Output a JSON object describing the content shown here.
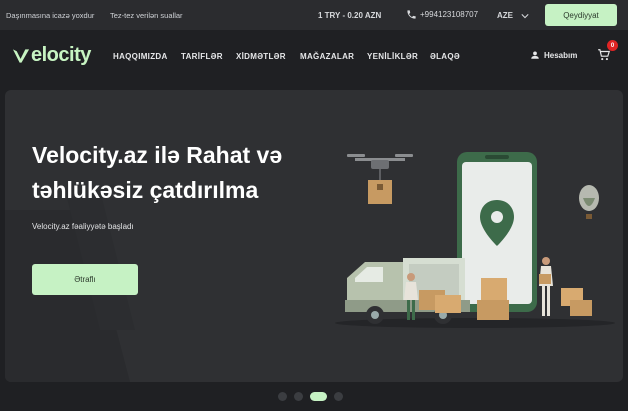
{
  "topbar": {
    "shipping_link": "Daşınmasına icazə yoxdur",
    "faq_link": "Tez-tez verilən suallar",
    "currency_rate": "1 TRY - 0.20 AZN",
    "phone": "+994123108707",
    "language": "AZE",
    "register_label": "Qeydiyyat"
  },
  "nav": {
    "logo": "elocity",
    "items": [
      {
        "label": "HAQQIMIZDA"
      },
      {
        "label": "TARİFLƏR"
      },
      {
        "label": "XİDMƏTLƏR"
      },
      {
        "label": "MAĞAZALAR"
      },
      {
        "label": "YENİLİKLƏR"
      },
      {
        "label": "ƏLAQƏ"
      }
    ],
    "account_label": "Hesabım",
    "cart_count": "0"
  },
  "hero": {
    "title_line1": "Velocity.az ilə Rahat və",
    "title_line2": "təhlükəsiz çatdırılma",
    "subtitle": "Velocity.az fəaliyyətə başladı",
    "cta_label": "Ətraflı"
  },
  "carousel": {
    "slide_count": 4,
    "active_index": 2
  },
  "colors": {
    "accent": "#c6f2c4",
    "background": "#1f2023",
    "hero_bg": "#2f3033",
    "badge": "#e02424"
  }
}
